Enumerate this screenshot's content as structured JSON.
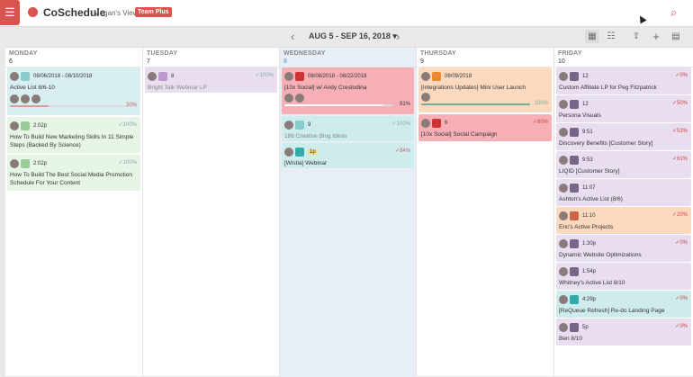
{
  "app": {
    "brand": "CoSchedule",
    "view": "Megan's View",
    "plan": "Team Plus"
  },
  "toolbar": {
    "prev": "‹",
    "next": "›",
    "range": "AUG 5 - SEP 16, 2018",
    "dropdown": "▾"
  },
  "days": [
    {
      "name": "MONDAY",
      "num": "6"
    },
    {
      "name": "TUESDAY",
      "num": "7"
    },
    {
      "name": "WEDNESDAY",
      "num": "8"
    },
    {
      "name": "THURSDAY",
      "num": "9"
    },
    {
      "name": "FRIDAY",
      "num": "10"
    }
  ],
  "mon": [
    {
      "meta": "08/06/2018 - 08/10/2018",
      "title": "Active List 8/6-10",
      "pct": "30%"
    },
    {
      "meta": "2:02p",
      "title": "How To Build New Marketing Skills In 11 Simple Steps (Backed By Science)",
      "pct": "✓100%"
    },
    {
      "meta": "2:02p",
      "title": "How To Build The Best Social Media Promotion Schedule For Your Content",
      "pct": "✓100%"
    }
  ],
  "tue": [
    {
      "meta": "8",
      "title": "Bright Talk Webinar LP",
      "pct": "✓100%"
    }
  ],
  "wed": [
    {
      "meta": "08/08/2018 - 08/22/2018",
      "title": "[10x Social] w/ Andy Crestodina",
      "pct": "91%"
    },
    {
      "meta": "9",
      "title": "186 Creative Blog Ideas",
      "pct": "✓100%"
    },
    {
      "meta": "1p",
      "title": "[Wistia] Webinar",
      "pct": "✓84%"
    }
  ],
  "thu": [
    {
      "meta": "08/09/2018",
      "title": "[Integrations Updates] Mini User Launch",
      "pct": "100%"
    },
    {
      "meta": "6",
      "title": "[10x Social] Social Campaign",
      "pct": "✓80%"
    }
  ],
  "fri": [
    {
      "meta": "12",
      "title": "Custom Affiliate LP for Peg Fitzpatrick",
      "pct": "✓0%"
    },
    {
      "meta": "12",
      "title": "Persona Visuals",
      "pct": "✓50%"
    },
    {
      "meta": "9:51",
      "title": "Discovery Benefits [Customer Story]",
      "pct": "✓53%"
    },
    {
      "meta": "9:53",
      "title": "LIQID [Customer Story]",
      "pct": "✓61%"
    },
    {
      "meta": "11:07",
      "title": "Ashton's Active List (8/6)",
      "pct": ""
    },
    {
      "meta": "11:10",
      "title": "Eric's Active Projects",
      "pct": "✓20%"
    },
    {
      "meta": "1:30p",
      "title": "Dynamic Website Optimizations",
      "pct": "✓0%"
    },
    {
      "meta": "1:54p",
      "title": "Whitney's Active List 8/10",
      "pct": ""
    },
    {
      "meta": "4:29p",
      "title": "[ReQueue Refresh] Re-do Landing Page",
      "pct": "✓0%"
    },
    {
      "meta": "5p",
      "title": "Ben 8/10",
      "pct": "✓0%"
    }
  ]
}
